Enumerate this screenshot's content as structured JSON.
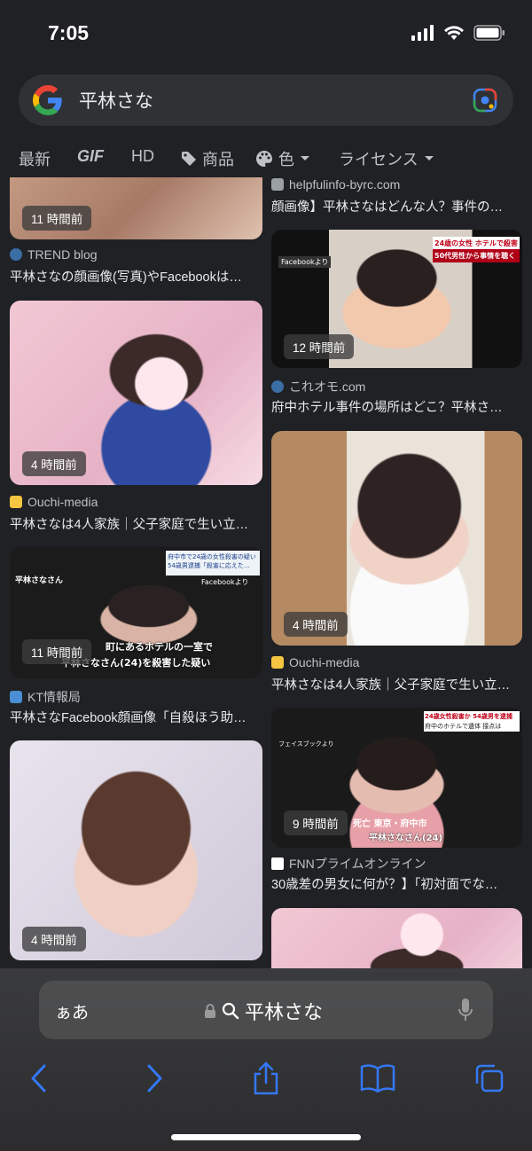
{
  "status_bar": {
    "time": "7:05"
  },
  "search": {
    "query": "平林さな",
    "logo": "google-g-icon",
    "lens_icon": "google-lens-icon"
  },
  "filters": [
    {
      "label": "最新"
    },
    {
      "label": "GIF"
    },
    {
      "label": "HD"
    },
    {
      "label": "商品",
      "icon": "tag-icon"
    },
    {
      "label": "色",
      "icon": "palette-icon",
      "dropdown": true
    },
    {
      "label": "ライセンス",
      "dropdown": true
    }
  ],
  "results": {
    "left": [
      {
        "badge": "11 時間前",
        "source": "TREND blog",
        "caption": "平林さなの顔画像(写真)やFacebookは…"
      },
      {
        "badge": "4 時間前",
        "source": "Ouchi-media",
        "caption": "平林さなは4人家族｜父子家庭で生い立…"
      },
      {
        "badge": "11 時間前",
        "source": "KT情報局",
        "caption": "平林さなFacebook顔画像「自殺ほう助…"
      },
      {
        "badge": "4 時間前"
      }
    ],
    "right": [
      {
        "source": "helpfulinfo-byrc.com",
        "caption": "顔画像】平林さなはどんな人？事件の…"
      },
      {
        "badge": "12 時間前",
        "source": "これオモ.com",
        "caption": "府中ホテル事件の場所はどこ？平林さ…"
      },
      {
        "badge": "4 時間前",
        "source": "Ouchi-media",
        "caption": "平林さなは4人家族｜父子家庭で生い立…"
      },
      {
        "badge": "9 時間前",
        "source": "FNNプライムオンライン",
        "caption": "30歳差の男女に何が？】「初対面でな…"
      },
      {}
    ]
  },
  "image_text": {
    "r2_tag": "Facebookより",
    "r2_headline1": "24歳の女性 ホテルで殺害",
    "r2_headline2": "50代男性から事情を聴く",
    "l3_name": "平林さなさん",
    "l3_top1": "府中市で24歳の女性殺害の疑い",
    "l3_top2": "54歳男逮捕「殺害に応えた…",
    "l3_fb": "Facebookより",
    "l3_bottom1": "町にあるホテルの一室で",
    "l3_bottom2": "平林さなさん(24)を殺害した疑い",
    "r4_tag": "フェイスブックより",
    "r4_top": "24歳女性殺害か 54歳男を逮捕",
    "r4_top2": "府中のホテルで遺体 接点は",
    "r4_place": "死亡 東京・府中市",
    "r4_name": "平林さなさん(24)"
  },
  "safari": {
    "aa_label": "ぁあ",
    "address_text": "平林さな",
    "icons": [
      "back-icon",
      "forward-icon",
      "share-icon",
      "bookmarks-icon",
      "tabs-icon"
    ]
  }
}
